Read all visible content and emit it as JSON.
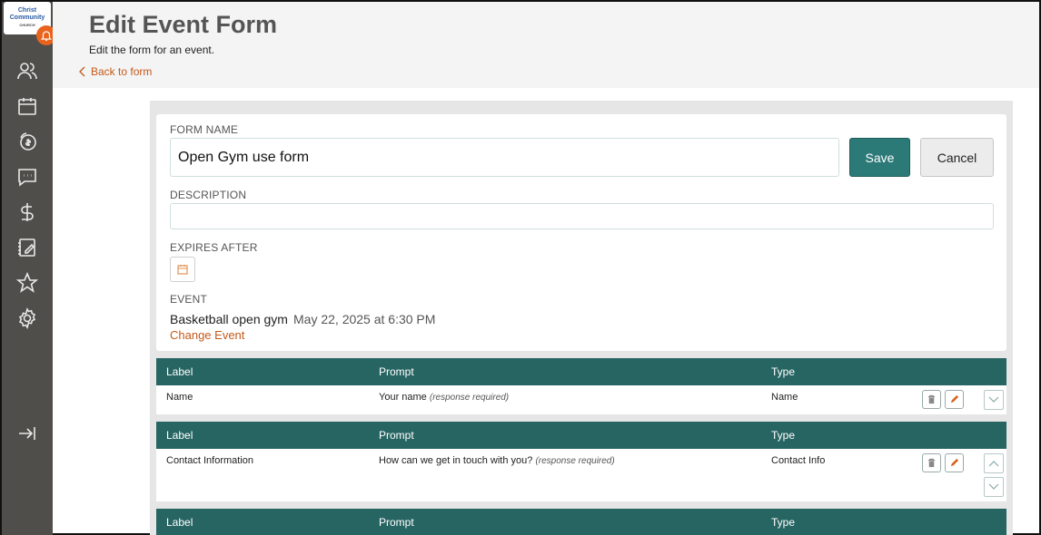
{
  "logo": {
    "line1": "Christ",
    "line2": "Community",
    "line3": "CHURCH"
  },
  "sidebar": {
    "items": [
      {
        "name": "people-icon"
      },
      {
        "name": "calendar-icon"
      },
      {
        "name": "giving-icon"
      },
      {
        "name": "chat-icon"
      },
      {
        "name": "dollar-icon"
      },
      {
        "name": "notebook-icon"
      },
      {
        "name": "star-icon"
      },
      {
        "name": "gear-icon"
      },
      {
        "name": "collapse-icon"
      }
    ]
  },
  "header": {
    "title": "Edit Event Form",
    "subtitle": "Edit the form for an event.",
    "back_label": "Back to form"
  },
  "form": {
    "name_label": "FORM NAME",
    "name_value": "Open Gym use form",
    "save_label": "Save",
    "cancel_label": "Cancel",
    "description_label": "DESCRIPTION",
    "description_value": "",
    "expires_label": "EXPIRES AFTER",
    "event_label": "EVENT",
    "event_name": "Basketball open gym",
    "event_date": "May 22, 2025 at 6:30 PM",
    "change_event_label": "Change Event"
  },
  "columns": {
    "label": "Label",
    "prompt": "Prompt",
    "type": "Type"
  },
  "fields": [
    {
      "label": "Name",
      "prompt": "Your name",
      "required": "(response required)",
      "type": "Name"
    },
    {
      "label": "Contact Information",
      "prompt": "How can we get in touch with you?",
      "required": "(response required)",
      "type": "Contact Info"
    }
  ],
  "colors": {
    "accent": "#276563",
    "link": "#c45a1a",
    "sidebar": "#4f4e4a"
  }
}
